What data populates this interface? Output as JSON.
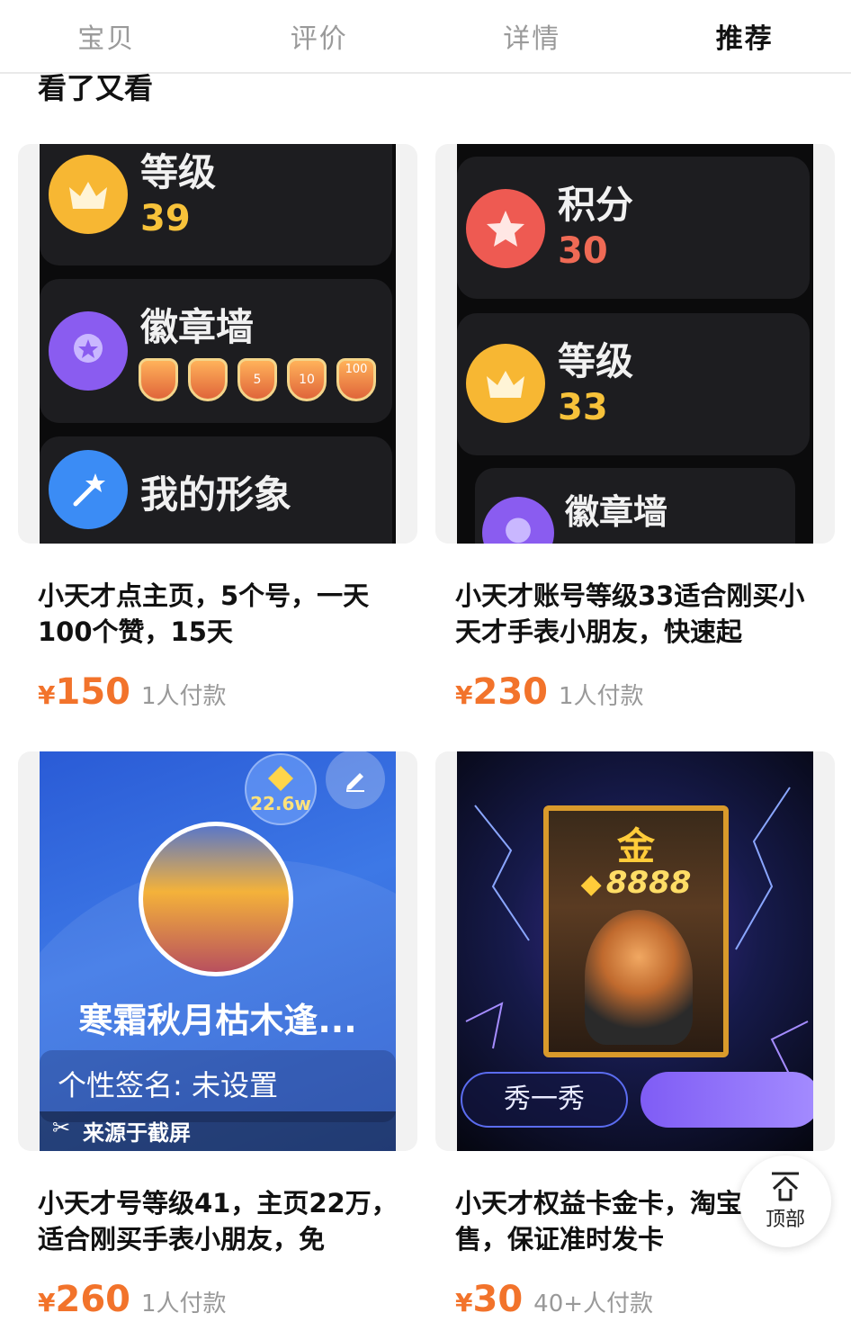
{
  "tabs": [
    "宝贝",
    "评价",
    "详情",
    "推荐"
  ],
  "active_tab": 3,
  "section_title": "看了又看",
  "products": [
    {
      "title": "小天才点主页，5个号，一天100个赞，15天",
      "currency": "¥",
      "price": "150",
      "paid": "1人付款",
      "image": {
        "level_label": "等级",
        "level_value": "39",
        "badges_label": "徽章墙",
        "badge_labels": [
          "5",
          "10",
          "100"
        ],
        "avatar_label": "我的形象"
      }
    },
    {
      "title": "小天才账号等级33适合刚买小天才手表小朋友，快速起",
      "currency": "¥",
      "price": "230",
      "paid": "1人付款",
      "image": {
        "points_label": "积分",
        "points_value": "30",
        "level_label": "等级",
        "level_value": "33",
        "badges_label": "徽章墙"
      }
    },
    {
      "title": "小天才号等级41，主页22万，适合刚买手表小朋友，免",
      "currency": "¥",
      "price": "260",
      "paid": "1人付款",
      "image": {
        "likes": "22.6w",
        "nickname": "寒霜秋月枯木逢...",
        "signature": "个性签名: 未设置",
        "source": "来源于截屏"
      }
    },
    {
      "title": "小天才权益卡金卡，淘宝直售，保证准时发卡",
      "currency": "¥",
      "price": "30",
      "paid": "40+人付款",
      "image": {
        "card_tier": "金",
        "card_points": "8888",
        "show_button": "秀一秀"
      }
    }
  ],
  "back_to_top": "顶部",
  "colors": {
    "price": "#f2732b",
    "tab_active": "#111111",
    "tab_inactive": "#9a9a9a"
  }
}
